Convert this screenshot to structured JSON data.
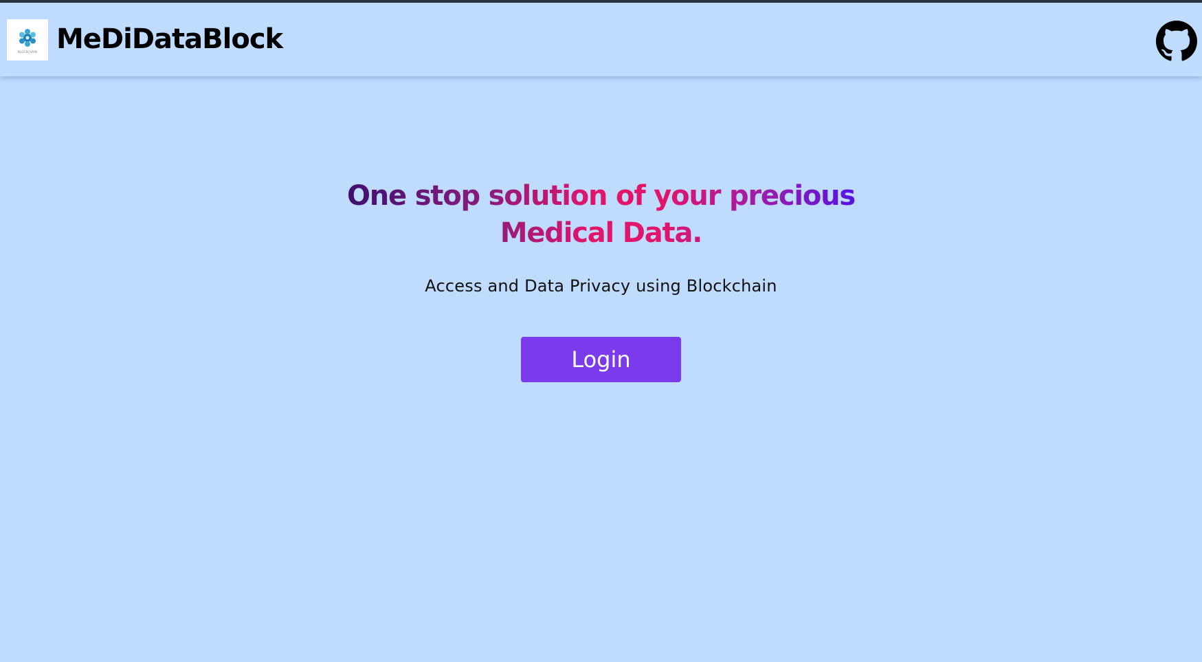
{
  "navbar": {
    "brand": "MeDiDataBlock",
    "logo_caption": "BLOCKCHAIN",
    "logo_icon": "blockchain-logo",
    "github_icon": "github-icon"
  },
  "hero": {
    "headline_line1": "One stop solution of your precious",
    "headline_line2": "Medical Data.",
    "subtitle": "Access and Data Privacy using Blockchain",
    "login_label": "Login"
  },
  "colors": {
    "background": "#bfdbfe",
    "button": "#7c3aed",
    "gradient": [
      "#3b0f6e",
      "#8a1c7c",
      "#e1156a",
      "#a01ca6",
      "#4f12e6"
    ]
  }
}
